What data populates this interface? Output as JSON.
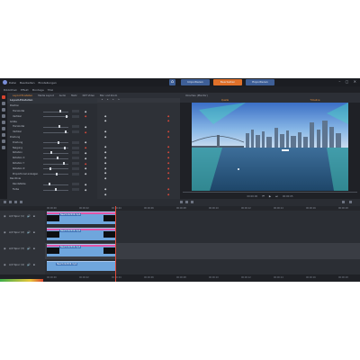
{
  "titlebar": {
    "menus": [
      "Datei",
      "Bearbeiten",
      "Einstellungen"
    ],
    "modes": [
      "Importieren",
      "Bearbeiten",
      "Exportieren"
    ],
    "active_mode": "Bearbeiten"
  },
  "top_tabs": [
    "Bibliothek",
    "Effekt",
    "Montage",
    "Titel"
  ],
  "effect_panel": {
    "tabs": [
      "Layout Einstellen",
      "Media Layout",
      "Audio",
      "Mehr",
      "NXT Video",
      "Blur und Zoom"
    ],
    "rows": [
      {
        "label": "Layout-Einstellen",
        "type": "section"
      },
      {
        "label": "Position",
        "type": "header"
      },
      {
        "label": "Horizontal",
        "type": "param"
      },
      {
        "label": "Vertikal",
        "type": "param"
      },
      {
        "label": "Größe",
        "type": "header"
      },
      {
        "label": "Horizontal",
        "type": "param"
      },
      {
        "label": "Vertikal",
        "type": "param"
      },
      {
        "label": "Drehung",
        "type": "header"
      },
      {
        "label": "Drehung",
        "type": "param"
      },
      {
        "label": "Neigung",
        "type": "param"
      },
      {
        "label": "Rotation",
        "type": "param"
      },
      {
        "label": "Rotation X",
        "type": "param"
      },
      {
        "label": "Rotation Y",
        "type": "param"
      },
      {
        "label": "Rotation Z",
        "type": "param"
      },
      {
        "label": "Proportional anzeigen",
        "type": "param"
      },
      {
        "label": "Randlinie",
        "type": "header"
      },
      {
        "label": "Randstärke",
        "type": "param"
      },
      {
        "label": "Farbe",
        "type": "param"
      }
    ]
  },
  "preview": {
    "title": "Vorschau (Monitor)",
    "tabs": [
      "Quelle",
      "Timeline"
    ],
    "active_tab": "Quelle",
    "time_left": "00:00:00",
    "time_right": "00:00:05"
  },
  "timeline": {
    "ruler": [
      "00:00:00",
      "00:00:02",
      "00:00:04",
      "00:00:06",
      "00:00:08",
      "00:00:10",
      "00:00:12",
      "00:00:14",
      "00:00:16",
      "00:00:18"
    ],
    "tracks": [
      {
        "name": "A/V Spur (1)",
        "clip_label": "NewYork2019.mp4"
      },
      {
        "name": "A/V Spur (2)",
        "clip_label": "NewYork2019.mp4"
      },
      {
        "name": "A/V Spur (3)",
        "clip_label": "NewYork2019.mp4"
      },
      {
        "name": "A/V Spur (4)",
        "clip_label": "NewYork2019.mp4"
      }
    ]
  },
  "colors": {
    "accent": "#e0712a",
    "mode_tab": "#3e5f97",
    "clip": "#6fa6dd",
    "playhead": "#e04a3a"
  }
}
